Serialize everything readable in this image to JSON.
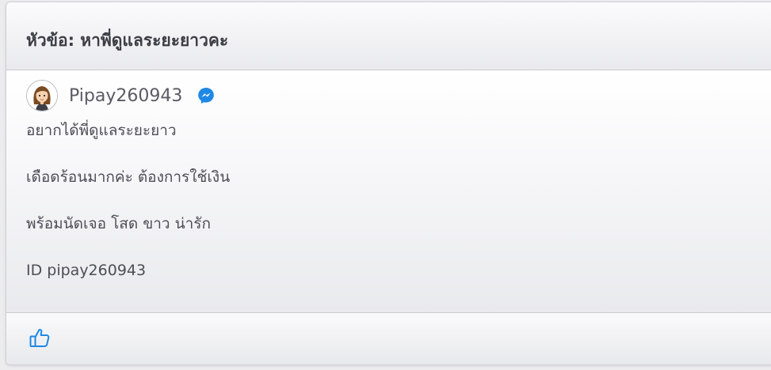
{
  "topic": {
    "title": "หัวข้อ: หาพี่ดูแลระยะยาวคะ"
  },
  "post": {
    "author": {
      "name": "Pipay260943",
      "avatar_icon": "girl-avatar",
      "contact_icon": "messenger-icon"
    },
    "lines": [
      "อยากได้พี่ดูแลระยะยาว",
      "เดือดร้อนมากค่ะ ต้องการใช้เงิน",
      "พร้อมนัดเจอ โสด ขาว น่ารัก",
      "ID pipay260943"
    ]
  },
  "footer": {
    "like_icon": "thumbs-up-icon"
  },
  "colors": {
    "accent_blue": "#1e88e5",
    "title_text": "#3c3d45",
    "body_text": "#4d4e56"
  }
}
